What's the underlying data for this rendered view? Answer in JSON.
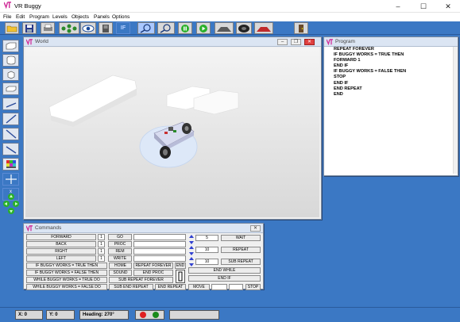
{
  "app": {
    "title": "VR Buggy",
    "min": "–",
    "max": "☐",
    "close": "✕"
  },
  "menu": [
    "File",
    "Edit",
    "Program",
    "Levels",
    "Objects",
    "Panels",
    "Options"
  ],
  "toolbar": {
    "icons": [
      "open-folder-icon",
      "save-icon",
      "print-icon",
      "network-icon",
      "eye-icon",
      "book-icon",
      "code-icon",
      "if-icon",
      "zoom-in-icon",
      "zoom-out-icon",
      "green-stop-icon",
      "green-play-icon",
      "road-ramp-icon",
      "tire-icon",
      "red-ramp-icon",
      "door-icon"
    ],
    "if_label": "IF"
  },
  "left_tools": {
    "icons": [
      "box-tool-icon",
      "cylinder-tool-icon",
      "cube-tool-icon",
      "slab-tool-icon",
      "line-tool-icon",
      "diagonal-line-icon",
      "diagonal-line-2-icon",
      "line-tool-3-icon",
      "color-palette-icon",
      "crosshair-icon",
      "axis-icon",
      "direction-pad-icon"
    ],
    "axis_label": "x\ny"
  },
  "world": {
    "title": "World"
  },
  "program": {
    "title": "Program",
    "lines": [
      "REPEAT FOREVER",
      "IF BUGGY WORKS = TRUE THEN",
      "FORWARD 1",
      "END IF",
      "IF BUGGY WORKS = FALSE THEN",
      "STOP",
      "END IF",
      "END REPEAT",
      "END"
    ]
  },
  "commands": {
    "title": "Commands",
    "rows": [
      {
        "label": "FORWARD",
        "value": "1",
        "cmd": "GO"
      },
      {
        "label": "BACK",
        "value": "1",
        "cmd": "PROC"
      },
      {
        "label": "RIGHT",
        "value": "1",
        "cmd": "REM"
      },
      {
        "label": "LEFT",
        "value": "1",
        "cmd": "WRITE"
      }
    ],
    "cond_rows": [
      {
        "label": "IF BUGGY WORKS = TRUE THEN",
        "a": "HOME",
        "b": "REPEAT FOREVER",
        "c": "END"
      },
      {
        "label": "IF BUGGY WORKS = FALSE THEN",
        "a": "SOUND",
        "b": "END PROC"
      },
      {
        "label": "WHILE BUGGY WORKS = TRUE DO",
        "a": "",
        "b": "SUB REPEAT FOREVER"
      },
      {
        "label": "WHILE BUGGY WORKS = FALSE DO",
        "a": "SUB END REPEAT",
        "b": "END REPEAT"
      }
    ],
    "right": [
      {
        "value": "5",
        "action": "WAIT"
      },
      {
        "value": "10",
        "action": "REPEAT"
      },
      {
        "value": "10",
        "action": "SUB REPEAT"
      }
    ],
    "end_while": "END WHILE",
    "end_if": "END IF",
    "move": "MOVE",
    "stop": "STOP"
  },
  "status": {
    "x": "X: 0",
    "y": "Y: 0",
    "heading": "Heading:  270°"
  }
}
